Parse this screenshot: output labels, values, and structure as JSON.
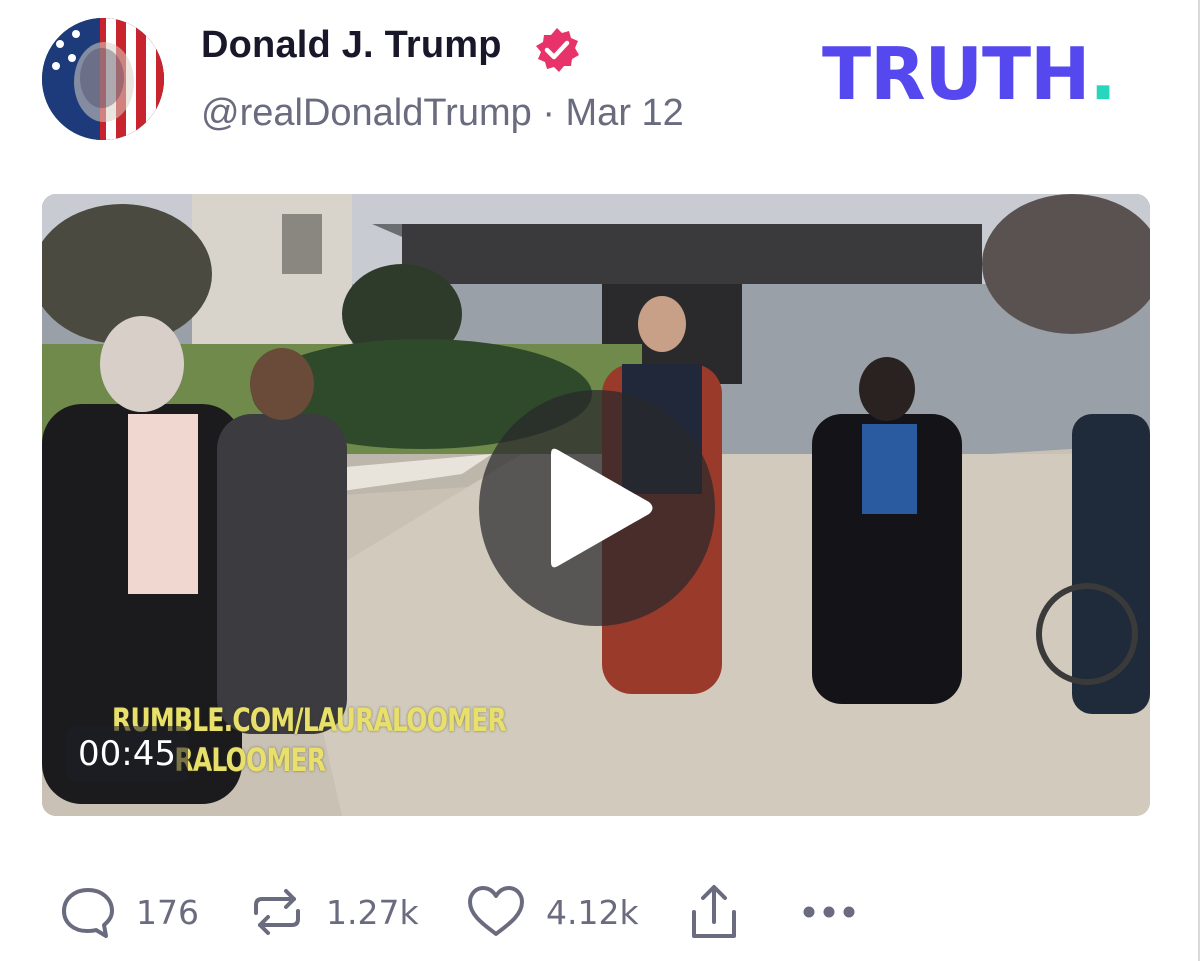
{
  "post": {
    "author": {
      "display_name": "Donald J. Trump",
      "handle": "@realDonaldTrump",
      "verified": true
    },
    "separator": "·",
    "date": "Mar 12",
    "video": {
      "duration": "00:45",
      "watermark_line1": "RUMBLE.COM/LAURALOOMER",
      "watermark_line2": "RALOOMER"
    },
    "stats": {
      "replies": "176",
      "reposts": "1.27k",
      "likes": "4.12k"
    }
  },
  "brand": {
    "name": "TRUTH",
    "dot": "."
  },
  "icons": [
    "verified-badge-icon",
    "reply-icon",
    "repost-icon",
    "like-icon",
    "share-icon",
    "more-options-icon",
    "play-icon"
  ],
  "colors": {
    "brand_purple": "#5448ee",
    "brand_teal": "#26d7bd",
    "verified_pink": "#e8326a",
    "muted_text": "#6b6b80",
    "name_text": "#18182a"
  }
}
